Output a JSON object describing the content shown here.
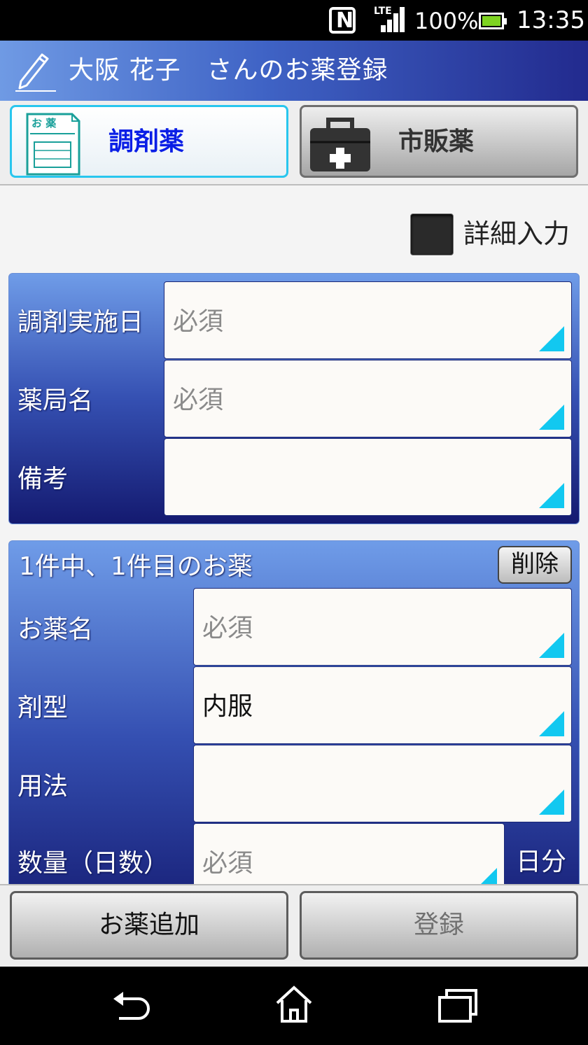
{
  "status_bar": {
    "nfc_label": "N",
    "network": "LTE",
    "battery_percent": "100%",
    "time": "13:35"
  },
  "header": {
    "title": "大阪 花子　さんのお薬登録"
  },
  "tabs": {
    "dispensed": {
      "label": "調剤薬",
      "icon": "prescription-envelope-icon",
      "icon_text": "お 薬"
    },
    "otc": {
      "label": "市販薬",
      "icon": "first-aid-kit-icon"
    }
  },
  "detail_input": {
    "label": "詳細入力",
    "checked": false
  },
  "prescription": {
    "fields": [
      {
        "label": "調剤実施日",
        "placeholder": "必須",
        "value": ""
      },
      {
        "label": "薬局名",
        "placeholder": "必須",
        "value": ""
      },
      {
        "label": "備考",
        "placeholder": "",
        "value": ""
      }
    ]
  },
  "medicine": {
    "header": "1件中、1件目のお薬",
    "delete_label": "削除",
    "fields": [
      {
        "label": "お薬名",
        "placeholder": "必須",
        "value": ""
      },
      {
        "label": "剤型",
        "placeholder": "",
        "value": "内服"
      },
      {
        "label": "用法",
        "placeholder": "",
        "value": ""
      },
      {
        "label": "数量（日数）",
        "placeholder": "必須",
        "value": ""
      }
    ],
    "quantity_unit": "日分"
  },
  "bottom_buttons": {
    "add_label": "お薬追加",
    "register_label": "登録"
  },
  "colors": {
    "accent_cyan": "#12c8f0",
    "tab_selected_text": "#0a1ee6",
    "panel_top": "#6f9ce8",
    "panel_bottom": "#141a70"
  }
}
